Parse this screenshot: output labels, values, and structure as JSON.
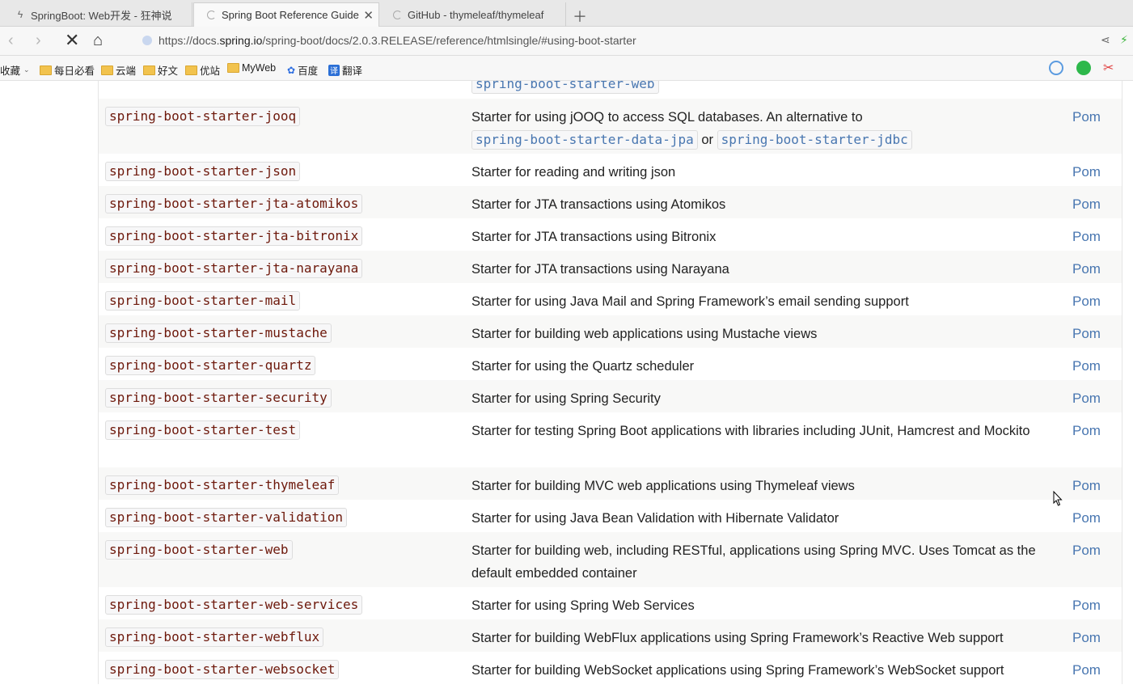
{
  "tabs": [
    {
      "label": "SpringBoot: Web开发 - 狂神说",
      "icon": "springboot-icon"
    },
    {
      "label": "Spring Boot Reference Guide",
      "icon": "loading-icon",
      "active": true
    },
    {
      "label": "GitHub - thymeleaf/thymeleaf",
      "icon": "loading-icon"
    }
  ],
  "address": {
    "prefix": "https://docs.",
    "domain": "spring.io",
    "path": "/spring-boot/docs/2.0.3.RELEASE/reference/htmlsingle/#using-boot-starter"
  },
  "bookmarks": {
    "favorites": "收藏",
    "items": [
      "每日必看",
      "云端",
      "好文",
      "优站",
      "MyWeb"
    ],
    "baidu": "百度",
    "fanyi": "翻译"
  },
  "table": {
    "top_partial_code": "spring-boot-starter-web",
    "rows": [
      {
        "name": "spring-boot-starter-jooq",
        "desc": "Starter for using jOOQ to access SQL databases. An alternative to",
        "desc_links": [
          "spring-boot-starter-data-jpa",
          "spring-boot-starter-jdbc"
        ],
        "desc_or": "or",
        "pom": "Pom"
      },
      {
        "name": "spring-boot-starter-json",
        "desc": "Starter for reading and writing json",
        "pom": "Pom"
      },
      {
        "name": "spring-boot-starter-jta-atomikos",
        "desc": "Starter for JTA transactions using Atomikos",
        "pom": "Pom"
      },
      {
        "name": "spring-boot-starter-jta-bitronix",
        "desc": "Starter for JTA transactions using Bitronix",
        "pom": "Pom"
      },
      {
        "name": "spring-boot-starter-jta-narayana",
        "desc": "Starter for JTA transactions using Narayana",
        "pom": "Pom"
      },
      {
        "name": "spring-boot-starter-mail",
        "desc": "Starter for using Java Mail and Spring Framework’s email sending support",
        "pom": "Pom"
      },
      {
        "name": "spring-boot-starter-mustache",
        "desc": "Starter for building web applications using Mustache views",
        "pom": "Pom"
      },
      {
        "name": "spring-boot-starter-quartz",
        "desc": "Starter for using the Quartz scheduler",
        "pom": "Pom"
      },
      {
        "name": "spring-boot-starter-security",
        "desc": "Starter for using Spring Security",
        "pom": "Pom"
      },
      {
        "name": "spring-boot-starter-test",
        "desc": "Starter for testing Spring Boot applications with libraries including JUnit, Hamcrest and Mockito",
        "pom": "Pom"
      },
      {
        "name": "spring-boot-starter-thymeleaf",
        "desc": "Starter for building MVC web applications using Thymeleaf views",
        "pom": "Pom"
      },
      {
        "name": "spring-boot-starter-validation",
        "desc": "Starter for using Java Bean Validation with Hibernate Validator",
        "pom": "Pom"
      },
      {
        "name": "spring-boot-starter-web",
        "desc": "Starter for building web, including RESTful, applications using Spring MVC. Uses Tomcat as the default embedded container",
        "pom": "Pom"
      },
      {
        "name": "spring-boot-starter-web-services",
        "desc": "Starter for using Spring Web Services",
        "pom": "Pom"
      },
      {
        "name": "spring-boot-starter-webflux",
        "desc": "Starter for building WebFlux applications using Spring Framework’s Reactive Web support",
        "pom": "Pom"
      },
      {
        "name": "spring-boot-starter-websocket",
        "desc": "Starter for building WebSocket applications using Spring Framework’s WebSocket support",
        "pom": "Pom"
      }
    ]
  }
}
